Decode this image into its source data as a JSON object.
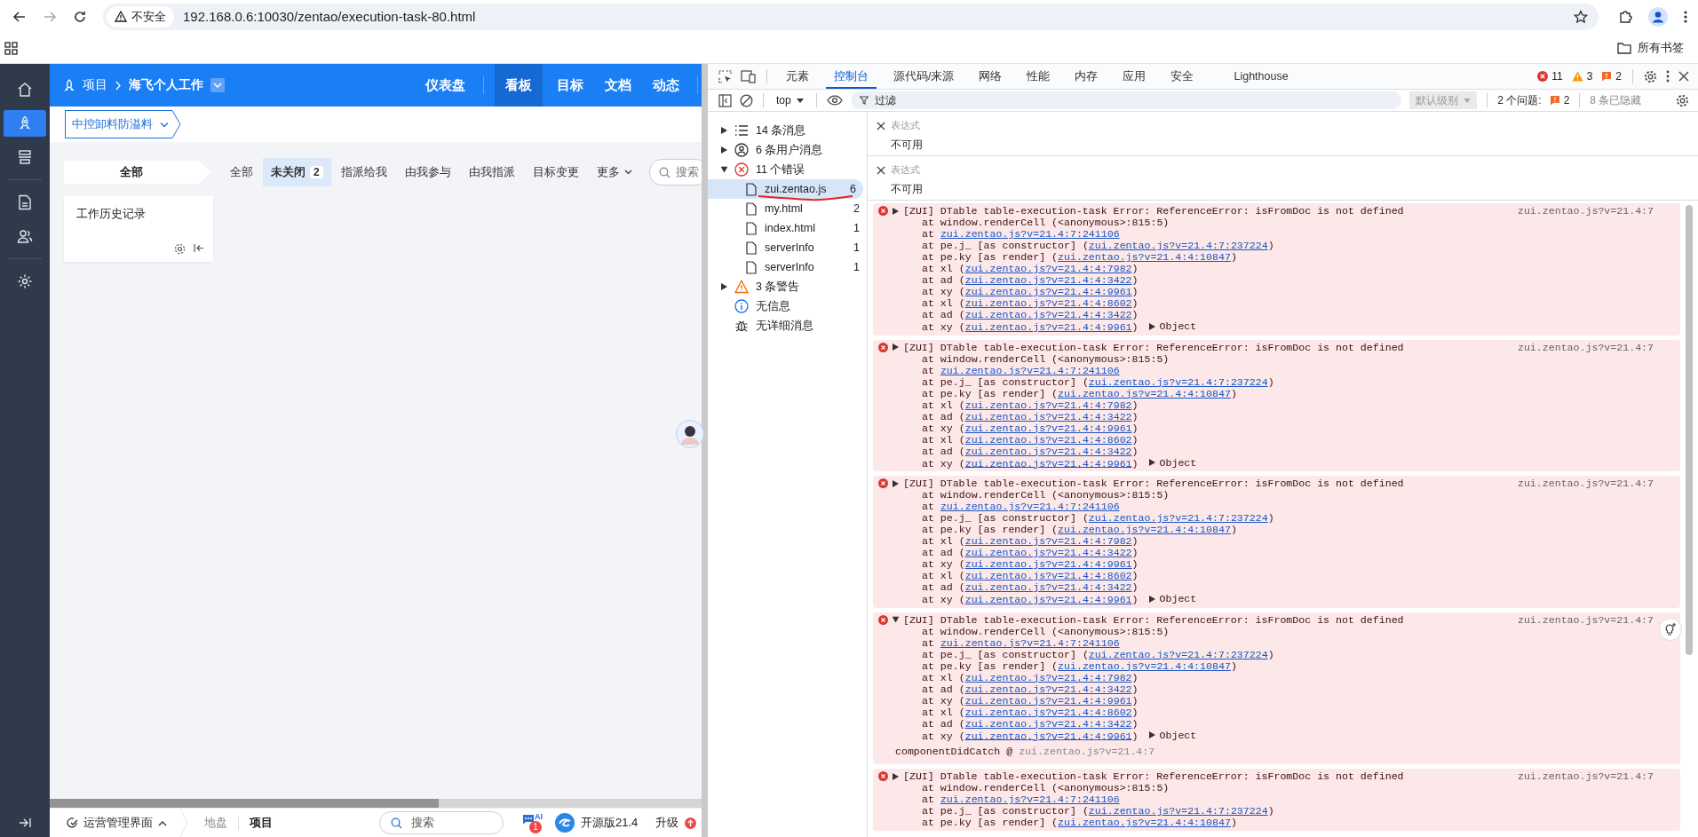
{
  "browser": {
    "security_label": "不安全",
    "url": "192.168.0.6:10030/zentao/execution-task-80.html",
    "bookmarks_label": "所有书签"
  },
  "app": {
    "nav": [
      {
        "kind": "home",
        "selected": false
      },
      {
        "kind": "project",
        "selected": true
      },
      {
        "kind": "layers",
        "selected": false
      },
      {
        "kind": "doc",
        "selected": false
      },
      {
        "kind": "users",
        "selected": false
      },
      {
        "kind": "settings",
        "selected": false
      }
    ],
    "header": {
      "section": "项目",
      "project": "海飞个人工作",
      "menu": [
        {
          "label": "仪表盘",
          "selected": false
        },
        {
          "label": "看板",
          "selected": true
        },
        {
          "label": "目标",
          "selected": false
        },
        {
          "label": "文档",
          "selected": false
        },
        {
          "label": "动态",
          "selected": false
        }
      ]
    },
    "selector": "中控卸料防溢料",
    "lane_header": "全部",
    "filters": [
      {
        "label": "全部",
        "selected": false
      },
      {
        "label": "未关闭",
        "count": "2",
        "selected": true
      },
      {
        "label": "指派给我",
        "selected": false
      },
      {
        "label": "由我参与",
        "selected": false
      },
      {
        "label": "由我指派",
        "selected": false
      },
      {
        "label": "目标变更",
        "selected": false
      },
      {
        "label": "更多",
        "selected": false
      }
    ],
    "search_placeholder": "搜索",
    "card_title": "工作历史记录",
    "bottom": {
      "workspace": "运营管理界面",
      "crumbs": [
        {
          "label": "地盘",
          "selected": false
        },
        {
          "label": "项目",
          "selected": true
        }
      ],
      "search_placeholder": "搜索",
      "ai_label": "AI",
      "ai_badge": "1",
      "edition": "开源版21.4",
      "upgrade": "升级"
    }
  },
  "devtools": {
    "tabs": [
      {
        "label": "元素",
        "selected": false
      },
      {
        "label": "控制台",
        "selected": true
      },
      {
        "label": "源代码/来源",
        "selected": false
      },
      {
        "label": "网络",
        "selected": false
      },
      {
        "label": "性能",
        "selected": false
      },
      {
        "label": "内存",
        "selected": false
      },
      {
        "label": "应用",
        "selected": false
      },
      {
        "label": "安全",
        "selected": false
      },
      {
        "label": "Lighthouse",
        "selected": false
      }
    ],
    "counts": {
      "errors": "11",
      "warnings": "3",
      "issues": "2"
    },
    "toolbar": {
      "context": "top",
      "filter_placeholder": "过滤",
      "level": "默认级别",
      "issues_label": "2 个问题:",
      "issues_count": "2",
      "hidden": "8 条已隐藏"
    },
    "groups": [
      {
        "kind": "list",
        "label": "14 条消息",
        "expanded": false
      },
      {
        "kind": "user",
        "label": "6 条用户消息",
        "expanded": false
      },
      {
        "kind": "error",
        "label": "11 个错误",
        "expanded": true,
        "children": [
          {
            "label": "zui.zentao.js",
            "count": "6",
            "selected": true
          },
          {
            "label": "my.html",
            "count": "2",
            "selected": false
          },
          {
            "label": "index.html",
            "count": "1",
            "selected": false
          },
          {
            "label": "serverInfo",
            "count": "1",
            "selected": false
          },
          {
            "label": "serverInfo",
            "count": "1",
            "selected": false
          }
        ]
      },
      {
        "kind": "warning",
        "label": "3 条警告",
        "expanded": false
      },
      {
        "kind": "info",
        "label": "无信息"
      },
      {
        "kind": "verbose",
        "label": "无详细消息"
      }
    ],
    "expressions": [
      {
        "label": "表达式",
        "value": "不可用"
      },
      {
        "label": "表达式",
        "value": "不可用"
      }
    ],
    "messages": [
      {
        "expanded": false,
        "text": "[ZUI] DTable table-execution-task Error: ReferenceError: isFromDoc is not defined",
        "source": "zui.zentao.js?v=21.4:7",
        "object_label": "Object",
        "stack": [
          {
            "pre": "at window.renderCell (<anonymous>:815:5)"
          },
          {
            "pre": "at ",
            "link": "zui.zentao.js?v=21.4:7:241106"
          },
          {
            "pre": "at pe.j_ [as constructor] (",
            "link": "zui.zentao.js?v=21.4:7:237224",
            "post": ")"
          },
          {
            "pre": "at pe.ky [as render] (",
            "link": "zui.zentao.js?v=21.4:4:10847",
            "post": ")"
          },
          {
            "pre": "at xl (",
            "link": "zui.zentao.js?v=21.4:4:7982",
            "post": ")"
          },
          {
            "pre": "at ad (",
            "link": "zui.zentao.js?v=21.4:4:3422",
            "post": ")"
          },
          {
            "pre": "at xy (",
            "link": "zui.zentao.js?v=21.4:4:9961",
            "post": ")"
          },
          {
            "pre": "at xl (",
            "link": "zui.zentao.js?v=21.4:4:8602",
            "post": ")"
          },
          {
            "pre": "at ad (",
            "link": "zui.zentao.js?v=21.4:4:3422",
            "post": ")"
          },
          {
            "pre": "at xy (",
            "link": "zui.zentao.js?v=21.4:4:9961",
            "post": ")"
          }
        ]
      },
      {
        "expanded": false,
        "text": "[ZUI] DTable table-execution-task Error: ReferenceError: isFromDoc is not defined",
        "source": "zui.zentao.js?v=21.4:7",
        "object_label": "Object",
        "stack": [
          {
            "pre": "at window.renderCell (<anonymous>:815:5)"
          },
          {
            "pre": "at ",
            "link": "zui.zentao.js?v=21.4:7:241106"
          },
          {
            "pre": "at pe.j_ [as constructor] (",
            "link": "zui.zentao.js?v=21.4:7:237224",
            "post": ")"
          },
          {
            "pre": "at pe.ky [as render] (",
            "link": "zui.zentao.js?v=21.4:4:10847",
            "post": ")"
          },
          {
            "pre": "at xl (",
            "link": "zui.zentao.js?v=21.4:4:7982",
            "post": ")"
          },
          {
            "pre": "at ad (",
            "link": "zui.zentao.js?v=21.4:4:3422",
            "post": ")"
          },
          {
            "pre": "at xy (",
            "link": "zui.zentao.js?v=21.4:4:9961",
            "post": ")"
          },
          {
            "pre": "at xl (",
            "link": "zui.zentao.js?v=21.4:4:8602",
            "post": ")"
          },
          {
            "pre": "at ad (",
            "link": "zui.zentao.js?v=21.4:4:3422",
            "post": ")"
          },
          {
            "pre": "at xy (",
            "link": "zui.zentao.js?v=21.4:4:9961",
            "post": ")"
          }
        ]
      },
      {
        "expanded": false,
        "text": "[ZUI] DTable table-execution-task Error: ReferenceError: isFromDoc is not defined",
        "source": "zui.zentao.js?v=21.4:7",
        "object_label": "Object",
        "stack": [
          {
            "pre": "at window.renderCell (<anonymous>:815:5)"
          },
          {
            "pre": "at ",
            "link": "zui.zentao.js?v=21.4:7:241106"
          },
          {
            "pre": "at pe.j_ [as constructor] (",
            "link": "zui.zentao.js?v=21.4:7:237224",
            "post": ")"
          },
          {
            "pre": "at pe.ky [as render] (",
            "link": "zui.zentao.js?v=21.4:4:10847",
            "post": ")"
          },
          {
            "pre": "at xl (",
            "link": "zui.zentao.js?v=21.4:4:7982",
            "post": ")"
          },
          {
            "pre": "at ad (",
            "link": "zui.zentao.js?v=21.4:4:3422",
            "post": ")"
          },
          {
            "pre": "at xy (",
            "link": "zui.zentao.js?v=21.4:4:9961",
            "post": ")"
          },
          {
            "pre": "at xl (",
            "link": "zui.zentao.js?v=21.4:4:8602",
            "post": ")"
          },
          {
            "pre": "at ad (",
            "link": "zui.zentao.js?v=21.4:4:3422",
            "post": ")"
          },
          {
            "pre": "at xy (",
            "link": "zui.zentao.js?v=21.4:4:9961",
            "post": ")"
          }
        ]
      },
      {
        "expanded": true,
        "text": "[ZUI] DTable table-execution-task Error: ReferenceError: isFromDoc is not defined",
        "source": "zui.zentao.js?v=21.4:7",
        "object_label": "Object",
        "caller": "componentDidCatch @",
        "caller_source": "zui.zentao.js?v=21.4:7",
        "stack": [
          {
            "pre": "at window.renderCell (<anonymous>:815:5)"
          },
          {
            "pre": "at ",
            "link": "zui.zentao.js?v=21.4:7:241106"
          },
          {
            "pre": "at pe.j_ [as constructor] (",
            "link": "zui.zentao.js?v=21.4:7:237224",
            "post": ")"
          },
          {
            "pre": "at pe.ky [as render] (",
            "link": "zui.zentao.js?v=21.4:4:10847",
            "post": ")"
          },
          {
            "pre": "at xl (",
            "link": "zui.zentao.js?v=21.4:4:7982",
            "post": ")"
          },
          {
            "pre": "at ad (",
            "link": "zui.zentao.js?v=21.4:4:3422",
            "post": ")"
          },
          {
            "pre": "at xy (",
            "link": "zui.zentao.js?v=21.4:4:9961",
            "post": ")"
          },
          {
            "pre": "at xl (",
            "link": "zui.zentao.js?v=21.4:4:8602",
            "post": ")"
          },
          {
            "pre": "at ad (",
            "link": "zui.zentao.js?v=21.4:4:3422",
            "post": ")"
          },
          {
            "pre": "at xy (",
            "link": "zui.zentao.js?v=21.4:4:9961",
            "post": ")"
          }
        ]
      },
      {
        "expanded": false,
        "text": "[ZUI] DTable table-execution-task Error: ReferenceError: isFromDoc is not defined",
        "source": "zui.zentao.js?v=21.4:7",
        "stack": [
          {
            "pre": "at window.renderCell (<anonymous>:815:5)"
          },
          {
            "pre": "at ",
            "link": "zui.zentao.js?v=21.4:7:241106"
          },
          {
            "pre": "at pe.j_ [as constructor] (",
            "link": "zui.zentao.js?v=21.4:7:237224",
            "post": ")"
          },
          {
            "pre": "at pe.ky [as render] (",
            "link": "zui.zentao.js?v=21.4:4:10847",
            "post": ")"
          }
        ]
      }
    ]
  }
}
